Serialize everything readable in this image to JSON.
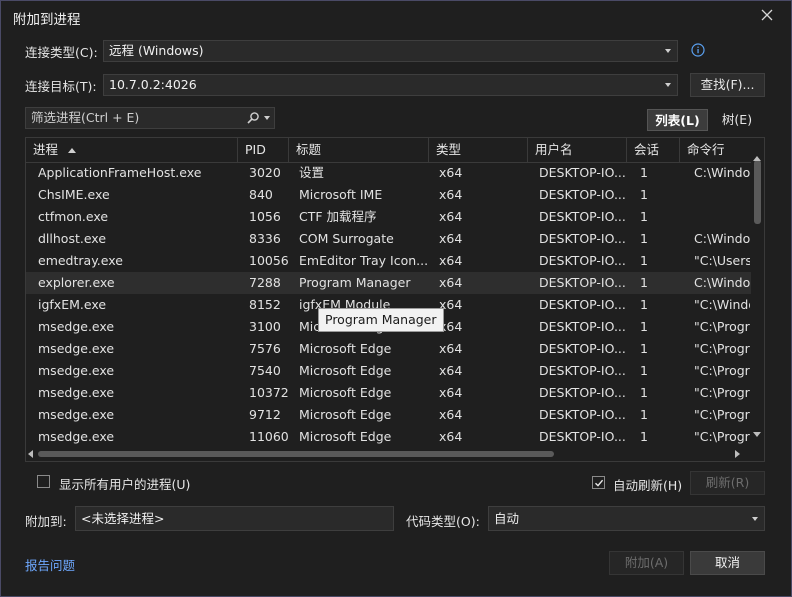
{
  "window": {
    "title": "附加到进程"
  },
  "connection_type": {
    "label": "连接类型(C):",
    "value": "远程 (Windows)"
  },
  "connection_target": {
    "label": "连接目标(T):",
    "value": "10.7.0.2:4026",
    "find_button": "查找(F)..."
  },
  "filter": {
    "placeholder": "筛选进程(Ctrl + E)"
  },
  "view_toggle": {
    "list": "列表(L)",
    "tree": "树(E)"
  },
  "grid": {
    "columns": [
      "进程",
      "PID",
      "标题",
      "类型",
      "用户名",
      "会话",
      "命令行"
    ],
    "rows": [
      [
        "ApplicationFrameHost.exe",
        "3020",
        "设置",
        "x64",
        "DESKTOP-IO...",
        "1",
        "C:\\Windo"
      ],
      [
        "ChsIME.exe",
        "840",
        "Microsoft IME",
        "x64",
        "DESKTOP-IO...",
        "1",
        ""
      ],
      [
        "ctfmon.exe",
        "1056",
        "CTF 加载程序",
        "x64",
        "DESKTOP-IO...",
        "1",
        ""
      ],
      [
        "dllhost.exe",
        "8336",
        "COM Surrogate",
        "x64",
        "DESKTOP-IO...",
        "1",
        "C:\\Windo"
      ],
      [
        "emedtray.exe",
        "10056",
        "EmEditor Tray Icon...",
        "x64",
        "DESKTOP-IO...",
        "1",
        "\"C:\\Users"
      ],
      [
        "explorer.exe",
        "7288",
        "Program Manager",
        "x64",
        "DESKTOP-IO...",
        "1",
        "C:\\Windo"
      ],
      [
        "igfxEM.exe",
        "8152",
        "igfxEM Module",
        "x64",
        "DESKTOP-IO...",
        "1",
        "\"C:\\Windo"
      ],
      [
        "msedge.exe",
        "3100",
        "Microsoft Edge",
        "x64",
        "DESKTOP-IO...",
        "1",
        "\"C:\\Progr"
      ],
      [
        "msedge.exe",
        "7576",
        "Microsoft Edge",
        "x64",
        "DESKTOP-IO...",
        "1",
        "\"C:\\Progr"
      ],
      [
        "msedge.exe",
        "7540",
        "Microsoft Edge",
        "x64",
        "DESKTOP-IO...",
        "1",
        "\"C:\\Progr"
      ],
      [
        "msedge.exe",
        "10372",
        "Microsoft Edge",
        "x64",
        "DESKTOP-IO...",
        "1",
        "\"C:\\Progr"
      ],
      [
        "msedge.exe",
        "9712",
        "Microsoft Edge",
        "x64",
        "DESKTOP-IO...",
        "1",
        "\"C:\\Progr"
      ],
      [
        "msedge.exe",
        "11060",
        "Microsoft Edge",
        "x64",
        "DESKTOP-IO...",
        "1",
        "\"C:\\Progr"
      ]
    ],
    "selected_row": 5,
    "tooltip": "Program Manager"
  },
  "show_all_users": {
    "label": "显示所有用户的进程(U)",
    "checked": false
  },
  "auto_refresh": {
    "label": "自动刷新(H)",
    "checked": true,
    "refresh_button": "刷新(R)"
  },
  "attach_to": {
    "label": "附加到:",
    "value": "<未选择进程>"
  },
  "code_type": {
    "label": "代码类型(O):",
    "value": "自动"
  },
  "footer": {
    "report_link": "报告问题",
    "attach_button": "附加(A)",
    "cancel_button": "取消"
  },
  "colors": {
    "accent": "#6ea8fe",
    "background": "#1f1f1f"
  }
}
